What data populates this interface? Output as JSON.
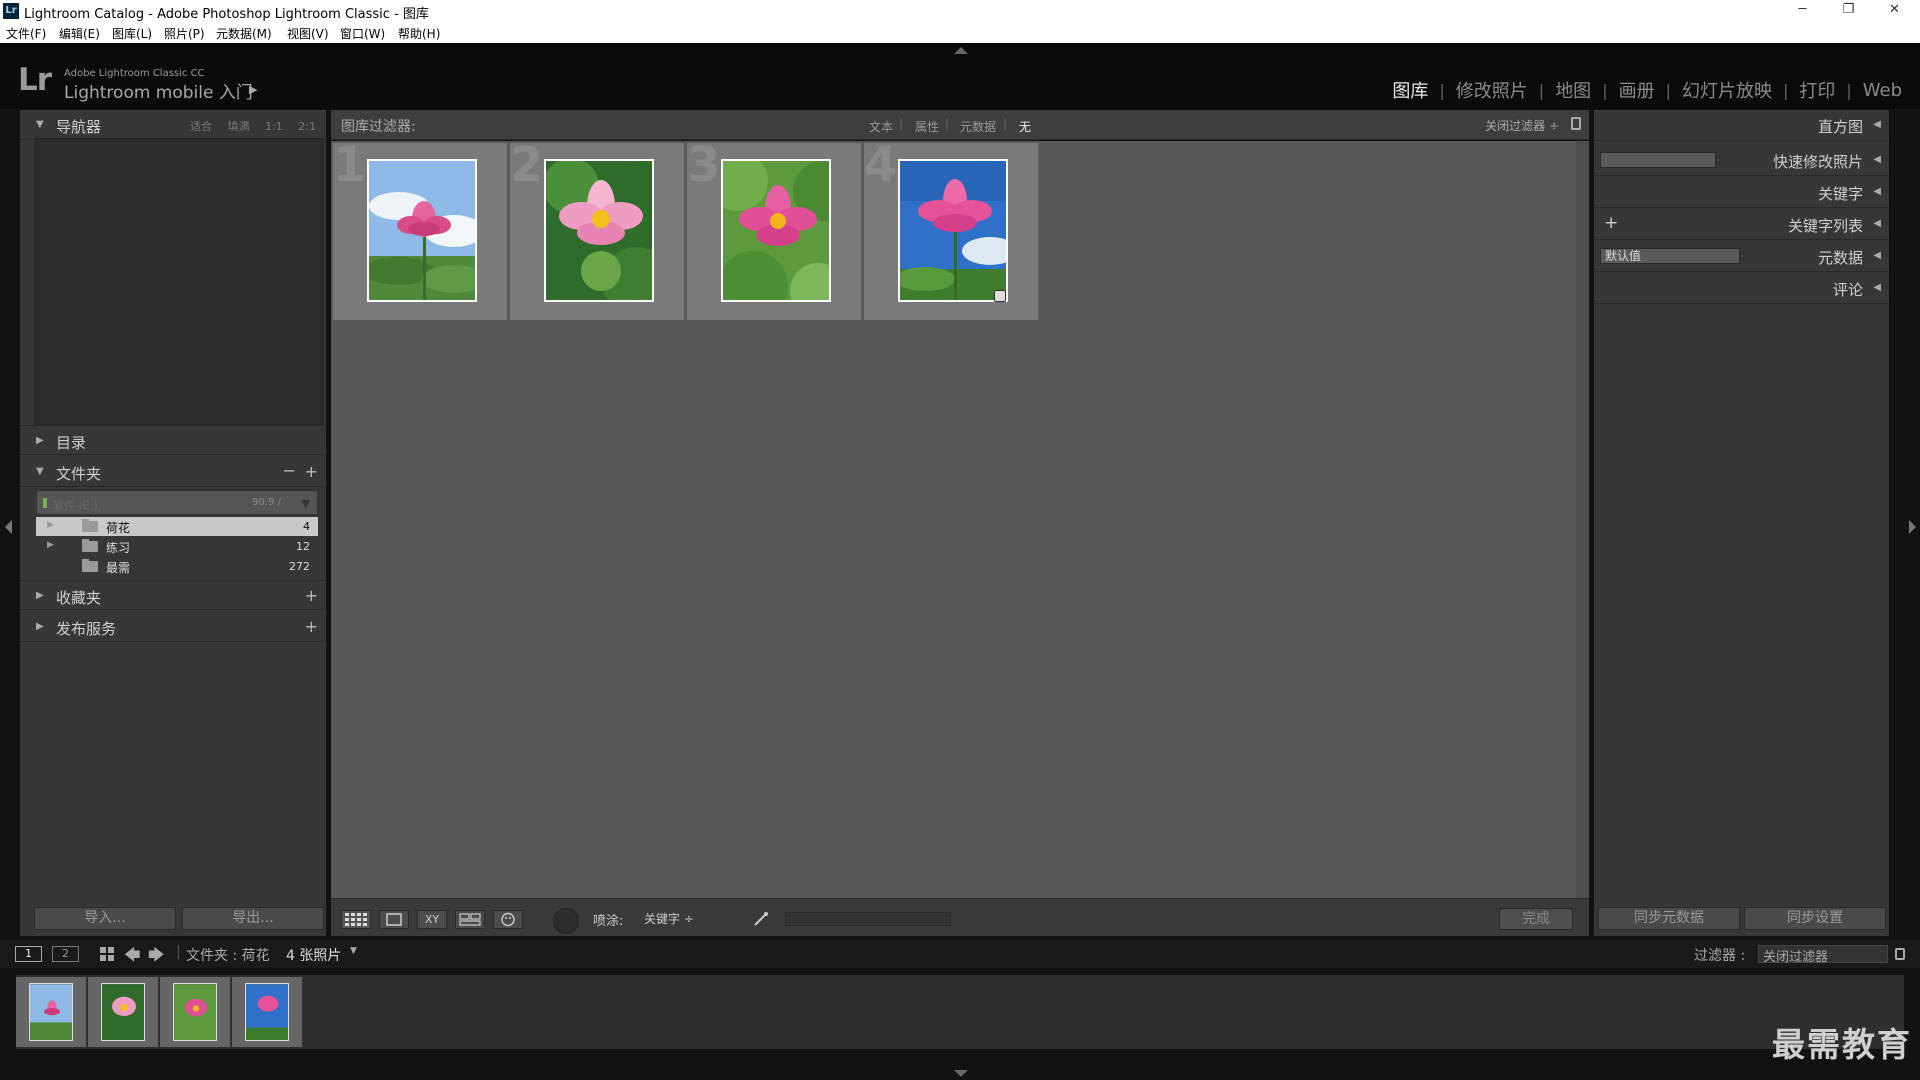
{
  "window": {
    "title": "Lightroom Catalog - Adobe Photoshop Lightroom Classic - 图库",
    "icon": "Lr",
    "minimize": "─",
    "restore": "❐",
    "close": "✕"
  },
  "menu": [
    "文件(F)",
    "编辑(E)",
    "图库(L)",
    "照片(P)",
    "元数据(M)",
    "视图(V)",
    "窗口(W)",
    "帮助(H)"
  ],
  "identity": {
    "logo": "Lr",
    "small": "Adobe Lightroom Classic CC",
    "main": "Lightroom mobile 入门",
    "arrow": "▶"
  },
  "modules": [
    {
      "label": "图库",
      "active": true
    },
    {
      "label": "修改照片",
      "active": false
    },
    {
      "label": "地图",
      "active": false
    },
    {
      "label": "画册",
      "active": false
    },
    {
      "label": "幻灯片放映",
      "active": false
    },
    {
      "label": "打印",
      "active": false
    },
    {
      "label": "Web",
      "active": false
    }
  ],
  "left": {
    "navigator": {
      "title": "导航器",
      "options": [
        "适合",
        "填满",
        "1:1",
        "2:1"
      ]
    },
    "catalog": {
      "title": "目录"
    },
    "folders": {
      "title": "文件夹",
      "volume": {
        "name": "软件 (E:)",
        "size": "90.9 /"
      },
      "items": [
        {
          "name": "荷花",
          "count": "4",
          "selected": true,
          "expandable": true
        },
        {
          "name": "练习",
          "count": "12",
          "selected": false,
          "expandable": true
        },
        {
          "name": "最需",
          "count": "272",
          "selected": false,
          "expandable": false
        }
      ]
    },
    "collections": {
      "title": "收藏夹"
    },
    "publish": {
      "title": "发布服务"
    },
    "import_label": "导入...",
    "export_label": "导出..."
  },
  "filter": {
    "title": "图库过滤器:",
    "options": [
      {
        "label": "文本",
        "active": false
      },
      {
        "label": "属性",
        "active": false
      },
      {
        "label": "元数据",
        "active": false
      },
      {
        "label": "无",
        "active": true
      }
    ],
    "preset": "关闭过滤器 ÷"
  },
  "grid": {
    "cells": [
      {
        "index": "1"
      },
      {
        "index": "2"
      },
      {
        "index": "3"
      },
      {
        "index": "4"
      }
    ]
  },
  "toolbar": {
    "spray_label": "喷涂:",
    "keyword_label": "关键字 ÷",
    "done_label": "完成",
    "xy_label": "XY"
  },
  "right": {
    "histogram": "直方图",
    "quick_develop": "快速修改照片",
    "keywording": "关键字",
    "keyword_list": "关键字列表",
    "keyword_plus": "+",
    "metadata": "元数据",
    "metadata_preset": "默认值",
    "comments": "评论",
    "sync_metadata": "同步元数据",
    "sync_settings": "同步设置"
  },
  "filmstrip": {
    "screen1": "1",
    "screen2": "2",
    "source": "文件夹 : 荷花",
    "count": "4 张照片",
    "filter_label": "过滤器 :",
    "filter_value": "关闭过滤器"
  },
  "watermark": "最需教育",
  "colors": {
    "active_module": "#e8e8e8",
    "panel": "#373737",
    "grid": "#585858",
    "cell": "#7a7a7a",
    "selected_folder": "#c8c8c8"
  }
}
